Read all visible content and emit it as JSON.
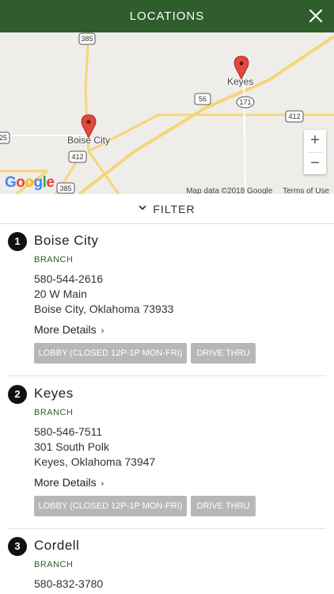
{
  "header": {
    "title": "LOCATIONS"
  },
  "map": {
    "cities": [
      "Boise City",
      "Keyes"
    ],
    "shields": [
      "385",
      "56",
      "171",
      "412",
      "412",
      "385",
      "25"
    ],
    "zoom_in": "+",
    "zoom_out": "−",
    "google": [
      "G",
      "o",
      "o",
      "g",
      "l",
      "e"
    ],
    "attribution": "Map data ©2018 Google",
    "terms": "Terms of Use"
  },
  "filter": {
    "label": "FILTER"
  },
  "locations": [
    {
      "num": "1",
      "name": "Boise City",
      "type": "BRANCH",
      "phone": "580-544-2616",
      "street": "20 W Main",
      "city_state": "Boise City, Oklahoma 73933",
      "more": "More Details",
      "services": [
        "LOBBY (CLOSED 12P-1P MON-FRI)",
        "DRIVE THRU"
      ]
    },
    {
      "num": "2",
      "name": "Keyes",
      "type": "BRANCH",
      "phone": "580-546-7511",
      "street": "301 South Polk",
      "city_state": "Keyes, Oklahoma 73947",
      "more": "More Details",
      "services": [
        "LOBBY (CLOSED 12P-1P MON-FRI)",
        "DRIVE THRU"
      ]
    },
    {
      "num": "3",
      "name": "Cordell",
      "type": "BRANCH",
      "phone": "580-832-3780"
    }
  ],
  "colors": {
    "header": "#2f5d2c",
    "pin": "#e0493d",
    "road": "#f5d57a",
    "button": "#b7b7b7"
  }
}
